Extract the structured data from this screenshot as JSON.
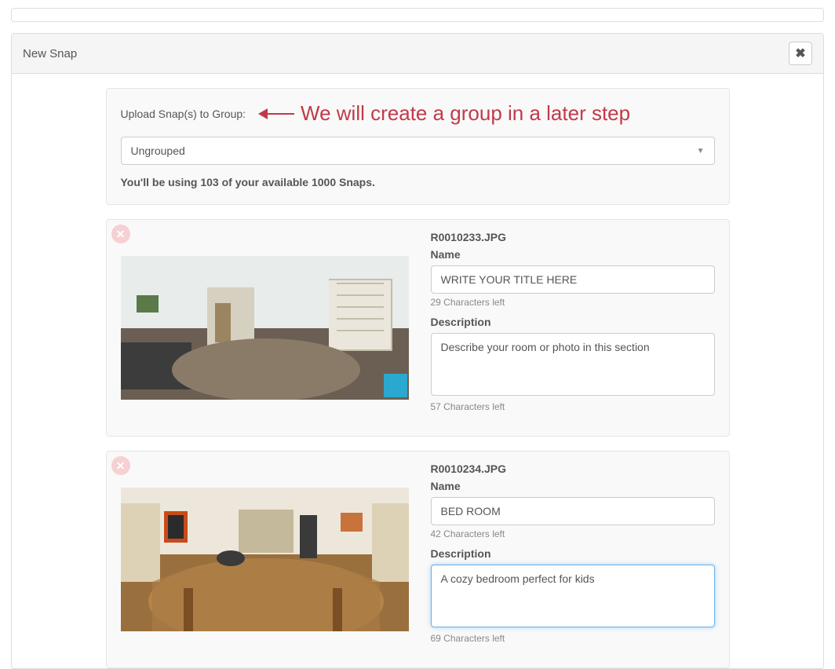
{
  "header": {
    "title": "New Snap"
  },
  "group": {
    "label": "Upload Snap(s) to Group:",
    "annotation": "We will create a group in a later step",
    "selected": "Ungrouped",
    "usage": "You'll be using 103 of your available 1000 Snaps."
  },
  "labels": {
    "name": "Name",
    "description": "Description"
  },
  "snaps": [
    {
      "filename": "R0010233.JPG",
      "name_value": "WRITE YOUR TITLE HERE",
      "name_chars_left": "29 Characters left",
      "desc_value": "Describe your room or photo in this section",
      "desc_chars_left": "57 Characters left",
      "desc_focused": false
    },
    {
      "filename": "R0010234.JPG",
      "name_value": "BED ROOM",
      "name_chars_left": "42 Characters left",
      "desc_value": "A cozy bedroom perfect for kids",
      "desc_chars_left": "69 Characters left",
      "desc_focused": true
    }
  ]
}
